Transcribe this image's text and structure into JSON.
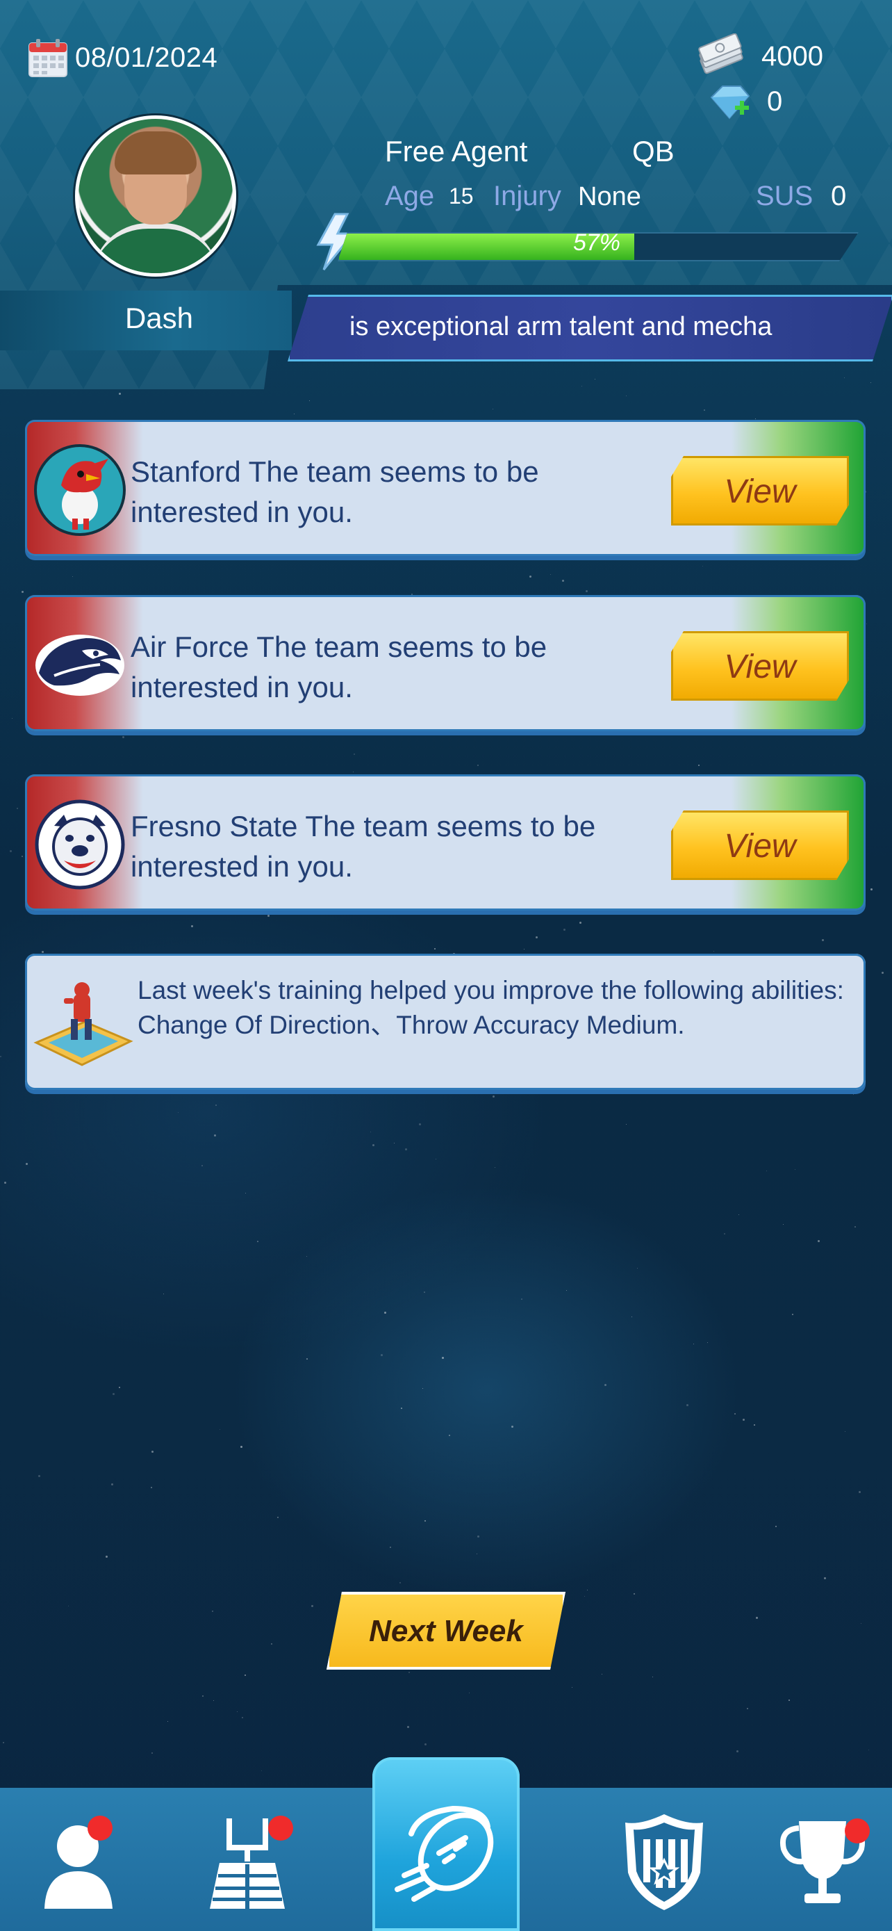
{
  "header": {
    "date": "08/01/2024",
    "cash": "4000",
    "gems": "0",
    "player_name": "Dash",
    "status": "Free Agent",
    "position": "QB",
    "age_label": "Age",
    "age_value": "15",
    "injury_label": "Injury",
    "injury_value": "None",
    "sus_label": "SUS",
    "sus_value": "0",
    "progress_percent": 57,
    "progress_text": "57%",
    "ticker_text": "is exceptional arm talent and mecha"
  },
  "offers": [
    {
      "team": "Stanford",
      "message": " Stanford The team seems to be interested in you.",
      "button": "View",
      "logo": "cardinal-bird-icon"
    },
    {
      "team": "Air Force",
      "message": "Air Force The team seems to be interested in you.",
      "button": "View",
      "logo": "falcon-head-icon"
    },
    {
      "team": "Fresno State",
      "message": "Fresno State The team seems to be interested in you.",
      "button": "View",
      "logo": "bulldog-icon"
    }
  ],
  "training": {
    "message": "Last week's training helped you improve the following abilities: Change Of Direction、Throw Accuracy Medium."
  },
  "actions": {
    "next_week": "Next Week"
  },
  "nav": [
    {
      "icon": "player-icon",
      "badge": true,
      "active": false
    },
    {
      "icon": "training-field-icon",
      "badge": true,
      "active": false
    },
    {
      "icon": "football-icon",
      "badge": false,
      "active": true
    },
    {
      "icon": "shield-icon",
      "badge": false,
      "active": false
    },
    {
      "icon": "trophy-icon",
      "badge": true,
      "active": false
    }
  ],
  "colors": {
    "accent_yellow": "#ffc21f",
    "progress_green": "#35b21e",
    "card_bg": "#d3e0f0",
    "text_blue": "#223f74",
    "badge_red": "#f02b2b"
  }
}
